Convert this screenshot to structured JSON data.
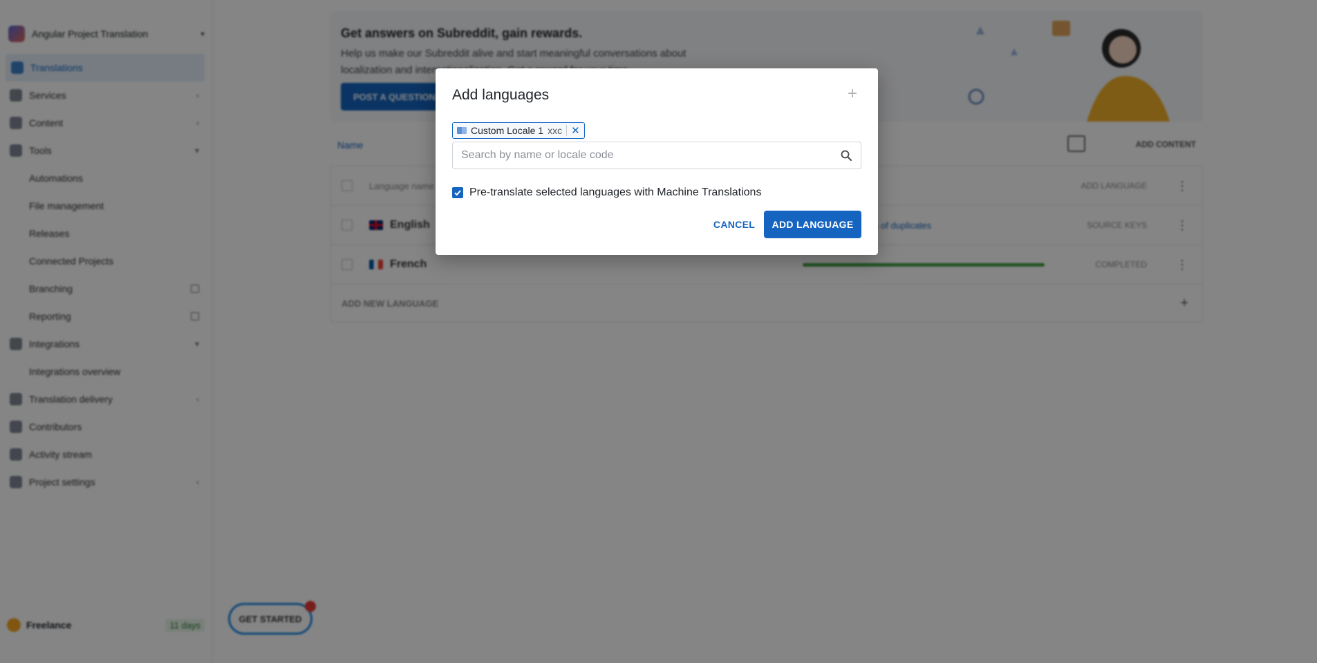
{
  "sidebar": {
    "project_name": "Angular Project Translation",
    "items": [
      {
        "label": "Translations",
        "icon": "translate-icon"
      },
      {
        "label": "Services",
        "icon": "services-icon"
      },
      {
        "label": "Content",
        "icon": "content-icon"
      },
      {
        "label": "Tools",
        "icon": "tools-icon"
      },
      {
        "label": "Automations"
      },
      {
        "label": "File management"
      },
      {
        "label": "Releases"
      },
      {
        "label": "Connected Projects"
      },
      {
        "label": "Branching"
      },
      {
        "label": "Reporting"
      },
      {
        "label": "Integrations",
        "icon": "integrations-icon"
      },
      {
        "label": "Integrations overview"
      },
      {
        "label": "Translation delivery",
        "icon": "delivery-icon"
      },
      {
        "label": "Contributors",
        "icon": "contributors-icon"
      },
      {
        "label": "Activity stream",
        "icon": "activity-icon"
      },
      {
        "label": "Project settings",
        "icon": "settings-icon"
      }
    ],
    "plan": {
      "label": "Freelance",
      "days": "11 days"
    },
    "get_started": "GET STARTED"
  },
  "main": {
    "banner": {
      "title": "Get answers on Subreddit, gain rewards.",
      "text": "Help us make our Subreddit alive and start meaningful conversations about localization and internationalization. Get a reward for your time.",
      "button": "POST A QUESTION"
    },
    "toolbar": {
      "name_label": "Name",
      "add_content": "ADD CONTENT"
    },
    "table": {
      "header_label": "Language name",
      "add_language_col": "ADD LANGUAGE",
      "rows": [
        {
          "lang": "English",
          "status": "SOURCE KEYS",
          "extra": "% of duplicates"
        },
        {
          "lang": "French",
          "status": "COMPLETED"
        }
      ],
      "add_new": "ADD NEW LANGUAGE"
    }
  },
  "dialog": {
    "title": "Add languages",
    "chip": {
      "label": "Custom Locale 1",
      "code": "xxc"
    },
    "search": {
      "placeholder": "Search by name or locale code",
      "value": ""
    },
    "pretranslate": {
      "label": "Pre-translate selected languages with Machine Translations",
      "checked": true
    },
    "cancel_label": "CANCEL",
    "add_label": "ADD LANGUAGE"
  }
}
